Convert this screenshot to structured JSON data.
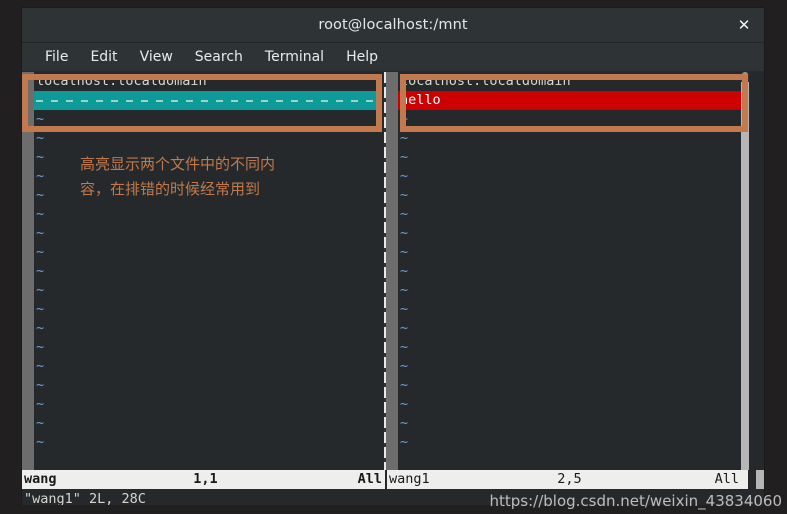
{
  "window": {
    "title": "root@localhost:/mnt",
    "close_label": "✕",
    "menu": [
      "File",
      "Edit",
      "View",
      "Search",
      "Terminal",
      "Help"
    ]
  },
  "editor": {
    "left_pane": {
      "header_line": "localhost.localdomain",
      "diff_line": "",
      "empty_marker": "~",
      "empty_count": 18,
      "diff_color": "#0f9a9a"
    },
    "right_pane": {
      "header_line": "localhost.localdomain",
      "diff_line": "hello",
      "empty_marker": "~",
      "empty_count": 18,
      "diff_color": "#cc0000"
    },
    "status_left": {
      "filename": "wang",
      "position": "1,1",
      "percent": "All"
    },
    "status_right": {
      "filename": "wang1",
      "position": "2,5",
      "percent": "All"
    },
    "message_line": "\"wang1\" 2L, 28C"
  },
  "annotations": {
    "box_color": "#c1794d",
    "note_line1": "高亮显示两个文件中的不同内",
    "note_line2": "容，在排错的时候经常用到"
  },
  "watermark": "https://blog.csdn.net/weixin_43834060"
}
